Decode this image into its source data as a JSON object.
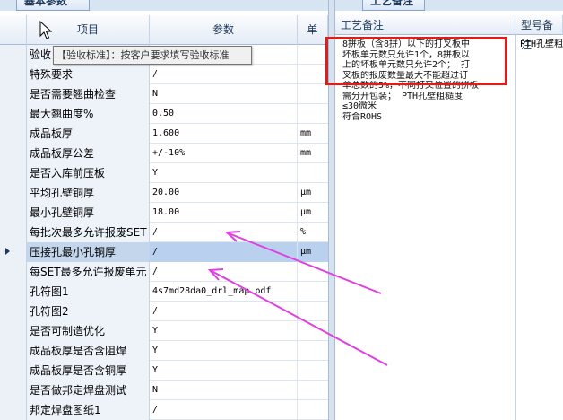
{
  "left_panel": {
    "tab_label": "基本参数",
    "header": {
      "item": "项目",
      "value": "参数",
      "unit": "单"
    },
    "tooltip": "【验收标准】：按客户要求填写验收标准",
    "rows": [
      {
        "item": "验收",
        "value": "",
        "unit": ""
      },
      {
        "item": "特殊要求",
        "value": "/",
        "unit": ""
      },
      {
        "item": "是否需要翘曲检查",
        "value": "N",
        "unit": ""
      },
      {
        "item": "最大翘曲度%",
        "value": "0.50",
        "unit": ""
      },
      {
        "item": "成品板厚",
        "value": "1.600",
        "unit": "mm"
      },
      {
        "item": "成品板厚公差",
        "value": "+/-10%",
        "unit": "mm"
      },
      {
        "item": "是否入库前压板",
        "value": "Y",
        "unit": ""
      },
      {
        "item": "平均孔壁铜厚",
        "value": "20.00",
        "unit": "μm"
      },
      {
        "item": "最小孔壁铜厚",
        "value": "18.00",
        "unit": "μm"
      },
      {
        "item": "每批次最多允许报废SET",
        "value": "/",
        "unit": "%"
      },
      {
        "item": "压接孔最小孔铜厚",
        "value": "/",
        "unit": "μm"
      },
      {
        "item": "每SET最多允许报废单元",
        "value": "/",
        "unit": ""
      },
      {
        "item": "孔符图1",
        "value": "4s7md28da0_drl_map.pdf",
        "unit": ""
      },
      {
        "item": "孔符图2",
        "value": "/",
        "unit": ""
      },
      {
        "item": "是否可制造优化",
        "value": "Y",
        "unit": ""
      },
      {
        "item": "成品板厚是否含阻焊",
        "value": "Y",
        "unit": ""
      },
      {
        "item": "成品板厚是否含铜厚",
        "value": "Y",
        "unit": ""
      },
      {
        "item": "是否做邦定焊盘测试",
        "value": "N",
        "unit": ""
      },
      {
        "item": "邦定焊盘图纸1",
        "value": "/",
        "unit": ""
      }
    ]
  },
  "right_panel": {
    "tab_label": "工艺备注",
    "header": {
      "remark": "工艺备注",
      "model": "型号备注"
    },
    "remark_lines": [
      "8拼板（含8拼）以下的打叉板中",
      "坏板单元数只允许1个，8拼板以",
      "上的坏板单元数只允许2个；  打",
      "叉板的报废数量最大不能超过订",
      "单总数的5%，不同打叉位置的拼板",
      "需分开包装；   PTH孔壁粗糙度",
      "≤30微米",
      "符合ROHS"
    ],
    "model_note": "PTH孔壁粗"
  },
  "colors": {
    "highlight": "#e21b1b",
    "arrow": "#e040e0",
    "selected_row": "#b9d1ef"
  }
}
